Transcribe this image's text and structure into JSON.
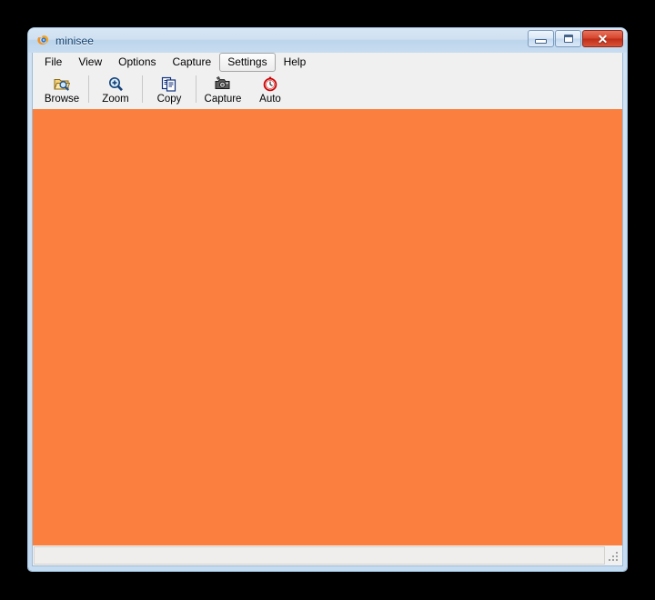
{
  "window": {
    "title": "minisee",
    "icon": "minisee-app-icon",
    "controls": {
      "minimize": {
        "name": "minimize-button",
        "glyph": "–"
      },
      "maximize": {
        "name": "maximize-button",
        "glyph": "□"
      },
      "close": {
        "name": "close-button",
        "glyph": "✕"
      }
    }
  },
  "menu": {
    "items": [
      {
        "label": "File",
        "active": false
      },
      {
        "label": "View",
        "active": false
      },
      {
        "label": "Options",
        "active": false
      },
      {
        "label": "Capture",
        "active": false
      },
      {
        "label": "Settings",
        "active": true
      },
      {
        "label": "Help",
        "active": false
      }
    ]
  },
  "toolbar": {
    "buttons": [
      {
        "label": "Browse",
        "icon": "folder-search-icon"
      },
      {
        "label": "Zoom",
        "icon": "magnifier-plus-icon"
      },
      {
        "label": "Copy",
        "icon": "copy-pages-icon"
      },
      {
        "label": "Capture",
        "icon": "camera-icon"
      },
      {
        "label": "Auto",
        "icon": "red-clock-icon"
      }
    ]
  },
  "canvas": {
    "name": "image-view",
    "fill_color": "#fb8040"
  },
  "status_bar": {
    "text": ""
  },
  "colors": {
    "canvas_orange": "#fb8040",
    "title_bar": "#cfe0f1",
    "frame_border": "#9ec4e4",
    "client_background": "#f0f0f0",
    "close_button_red": "#d6452c",
    "desktop_background": "#000000"
  }
}
